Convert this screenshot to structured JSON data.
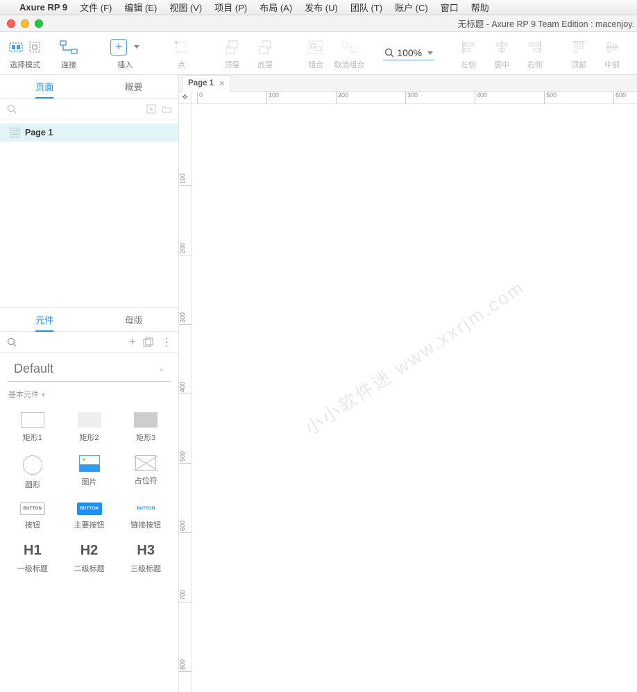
{
  "menubar": {
    "app": "Axure RP 9",
    "items": [
      "文件 (F)",
      "编辑 (E)",
      "视图 (V)",
      "项目 (P)",
      "布局 (A)",
      "发布 (U)",
      "团队 (T)",
      "账户 (C)",
      "窗口",
      "帮助"
    ]
  },
  "window_title": "无标题 - Axure RP 9 Team Edition : macenjoy.",
  "toolbar": {
    "select_mode": "选择模式",
    "connect": "连接",
    "insert": "插入",
    "point": "点",
    "top_layer": "顶层",
    "bottom_layer": "底层",
    "group": "组合",
    "ungroup": "取消组合",
    "zoom": "100%",
    "align_left": "左侧",
    "align_center": "居中",
    "align_right": "右侧",
    "align_top": "顶部",
    "align_middle": "中部"
  },
  "pages_panel": {
    "tab_pages": "页面",
    "tab_outline": "概要",
    "page1": "Page 1"
  },
  "widgets_panel": {
    "tab_widgets": "元件",
    "tab_masters": "母版",
    "library": "Default",
    "category": "基本元件",
    "items": {
      "rect1": "矩形1",
      "rect2": "矩形2",
      "rect3": "矩形3",
      "circle": "圆形",
      "image": "图片",
      "placeholder": "占位符",
      "button": "按钮",
      "primary_button": "主要按钮",
      "link_button": "链接按钮",
      "h1": "一级标题",
      "h2": "二级标题",
      "h3": "三级标题",
      "btn_text": "BUTTON",
      "h1_g": "H1",
      "h2_g": "H2",
      "h3_g": "H3"
    }
  },
  "canvas": {
    "tab": "Page 1",
    "h_ticks": [
      "0",
      "100",
      "200",
      "300",
      "400",
      "500",
      "600"
    ],
    "v_ticks": [
      "100",
      "200",
      "300",
      "400",
      "500",
      "600",
      "700",
      "800"
    ],
    "watermark": "小小软件迷 www.xxrjm.com"
  }
}
